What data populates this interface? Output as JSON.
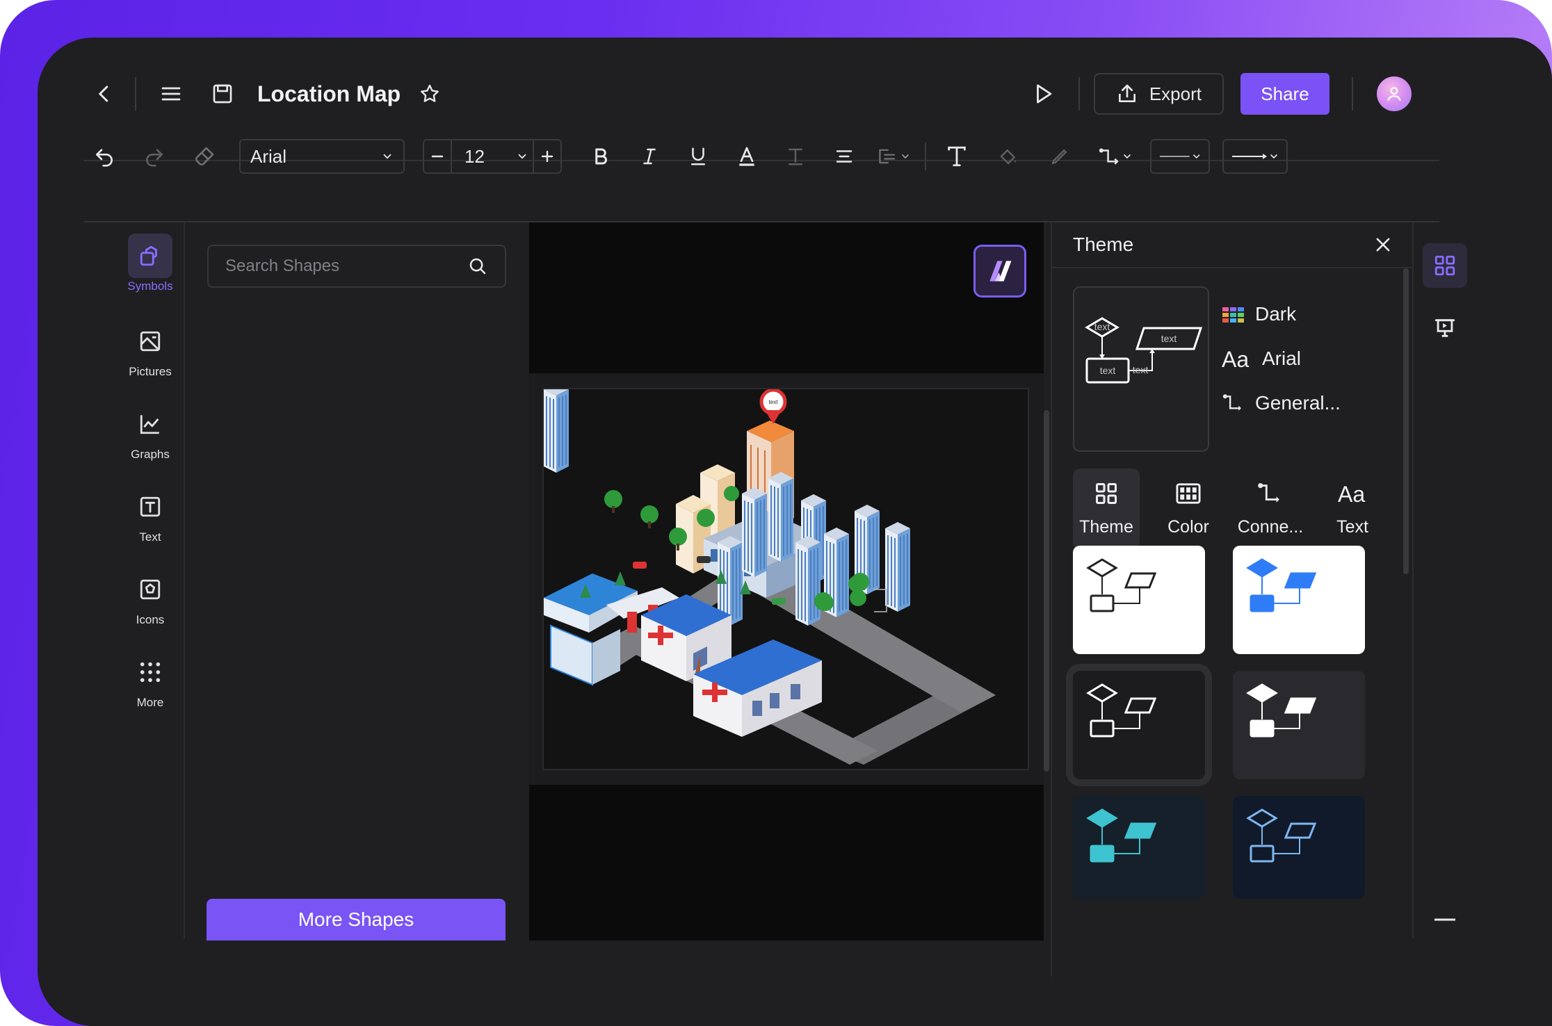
{
  "header": {
    "title": "Location Map",
    "export_label": "Export",
    "share_label": "Share"
  },
  "toolbar": {
    "font_family": "Arial",
    "font_size": "12"
  },
  "sidebar": {
    "items": [
      {
        "label": "Symbols",
        "icon": "shapes-icon"
      },
      {
        "label": "Pictures",
        "icon": "picture-icon"
      },
      {
        "label": "Graphs",
        "icon": "graph-icon"
      },
      {
        "label": "Text",
        "icon": "text-box-icon"
      },
      {
        "label": "Icons",
        "icon": "icons-icon"
      },
      {
        "label": "More",
        "icon": "grid-dots-icon"
      }
    ]
  },
  "shapes_panel": {
    "search_placeholder": "Search Shapes",
    "more_shapes_label": "More Shapes"
  },
  "canvas": {
    "pin_label": "text"
  },
  "theme_panel": {
    "title": "Theme",
    "preview_labels": {
      "decision": "text",
      "data": "text",
      "process": "text",
      "connector": "text"
    },
    "properties": [
      {
        "label": "Dark",
        "icon": "palette-icon"
      },
      {
        "label": "Arial",
        "icon": "font-icon"
      },
      {
        "label": "General...",
        "icon": "connector-icon"
      }
    ],
    "tabs": [
      {
        "label": "Theme",
        "icon": "theme-grid-icon",
        "active": true
      },
      {
        "label": "Color",
        "icon": "color-grid-icon",
        "active": false
      },
      {
        "label": "Conne...",
        "icon": "connector-icon",
        "active": false
      },
      {
        "label": "Text",
        "icon": "font-icon",
        "active": false
      }
    ],
    "themes": [
      {
        "bg": "#ffffff",
        "fill": "#ffffff",
        "stroke": "#222222",
        "line": "#222222"
      },
      {
        "bg": "#ffffff",
        "fill": "#2f7df6",
        "stroke": "#2f7df6",
        "line": "#2f7df6"
      },
      {
        "bg": "#1c1c1e",
        "fill": "#1c1c1e",
        "stroke": "#ffffff",
        "line": "#ffffff"
      },
      {
        "bg": "#2a2a2e",
        "fill": "#ffffff",
        "stroke": "#ffffff",
        "line": "#ffffff"
      },
      {
        "bg": "#15202a",
        "fill": "#3ec3d0",
        "stroke": "#3ec3d0",
        "line": "#3ec3d0"
      },
      {
        "bg": "#101a2a",
        "fill": "#101a2a",
        "stroke": "#7fb6f0",
        "line": "#7fb6f0"
      }
    ]
  },
  "colors": {
    "accent": "#7b52f5",
    "background": "#1f1f21",
    "canvas": "#0b0b0c"
  }
}
